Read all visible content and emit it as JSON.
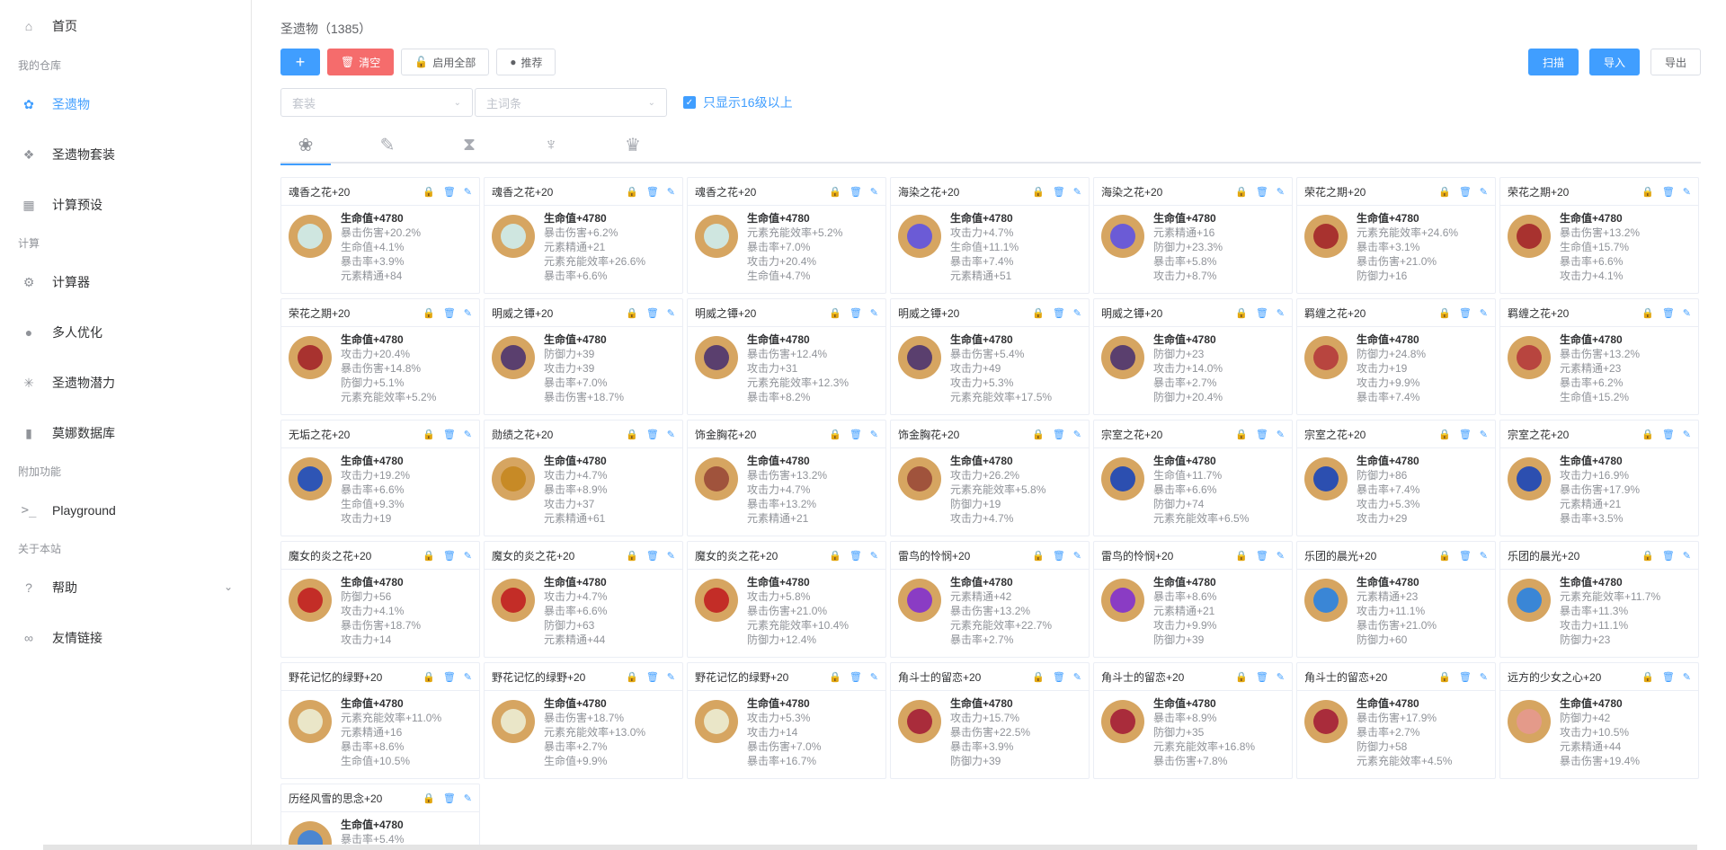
{
  "sidebar": {
    "home": "首页",
    "groups": [
      "我的仓库",
      "计算",
      "附加功能",
      "关于本站"
    ],
    "items": [
      {
        "label": "圣遗物",
        "icon": "artifact-icon"
      },
      {
        "label": "圣遗物套装",
        "icon": "set-icon"
      },
      {
        "label": "计算预设",
        "icon": "grid-icon"
      },
      {
        "label": "计算器",
        "icon": "chip-icon"
      },
      {
        "label": "多人优化",
        "icon": "bulb-icon"
      },
      {
        "label": "圣遗物潜力",
        "icon": "spark-icon"
      },
      {
        "label": "莫娜数据库",
        "icon": "bar-chart-icon"
      },
      {
        "label": "Playground",
        "icon": "terminal-icon"
      },
      {
        "label": "帮助",
        "icon": "help-icon"
      },
      {
        "label": "友情链接",
        "icon": "link-icon"
      }
    ]
  },
  "header": {
    "title": "圣遗物（1385）"
  },
  "toolbar": {
    "add": "+",
    "clear": "清空",
    "enable_all": "启用全部",
    "recommend": "推荐",
    "scan": "扫描",
    "import": "导入",
    "export": "导出"
  },
  "filters": {
    "set_placeholder": "套装",
    "main_placeholder": "主词条",
    "only_16": "只显示16级以上"
  },
  "tabs": [
    "flower-icon",
    "plume-icon",
    "sands-icon",
    "goblet-icon",
    "circlet-icon"
  ],
  "colors": {
    "primary": "#409eff",
    "danger": "#f56c6c",
    "avatar_bg": "#d6a561"
  },
  "cards": [
    {
      "name": "魂香之花+20",
      "main": "生命值+4780",
      "subs": [
        "暴击伤害+20.2%",
        "生命值+4.1%",
        "暴击率+3.9%",
        "元素精通+84"
      ],
      "gem": "#cfe6e0"
    },
    {
      "name": "魂香之花+20",
      "main": "生命值+4780",
      "subs": [
        "暴击伤害+6.2%",
        "元素精通+21",
        "元素充能效率+26.6%",
        "暴击率+6.6%"
      ],
      "gem": "#cfe6e0"
    },
    {
      "name": "魂香之花+20",
      "main": "生命值+4780",
      "subs": [
        "元素充能效率+5.2%",
        "暴击率+7.0%",
        "攻击力+20.4%",
        "生命值+4.7%"
      ],
      "gem": "#cfe6e0"
    },
    {
      "name": "海染之花+20",
      "main": "生命值+4780",
      "subs": [
        "攻击力+4.7%",
        "生命值+11.1%",
        "暴击率+7.4%",
        "元素精通+51"
      ],
      "gem": "#6b5bd6"
    },
    {
      "name": "海染之花+20",
      "main": "生命值+4780",
      "subs": [
        "元素精通+16",
        "防御力+23.3%",
        "暴击率+5.8%",
        "攻击力+8.7%"
      ],
      "gem": "#6b5bd6"
    },
    {
      "name": "荣花之期+20",
      "main": "生命值+4780",
      "subs": [
        "元素充能效率+24.6%",
        "暴击率+3.1%",
        "暴击伤害+21.0%",
        "防御力+16"
      ],
      "gem": "#a8322f"
    },
    {
      "name": "荣花之期+20",
      "main": "生命值+4780",
      "subs": [
        "暴击伤害+13.2%",
        "生命值+15.7%",
        "暴击率+6.6%",
        "攻击力+4.1%"
      ],
      "gem": "#a8322f"
    },
    {
      "name": "荣花之期+20",
      "main": "生命值+4780",
      "subs": [
        "攻击力+20.4%",
        "暴击伤害+14.8%",
        "防御力+5.1%",
        "元素充能效率+5.2%"
      ],
      "gem": "#a8322f"
    },
    {
      "name": "明威之镡+20",
      "main": "生命值+4780",
      "subs": [
        "防御力+39",
        "攻击力+39",
        "暴击率+7.0%",
        "暴击伤害+18.7%"
      ],
      "gem": "#5a3f6e"
    },
    {
      "name": "明威之镡+20",
      "main": "生命值+4780",
      "subs": [
        "暴击伤害+12.4%",
        "攻击力+31",
        "元素充能效率+12.3%",
        "暴击率+8.2%"
      ],
      "gem": "#5a3f6e"
    },
    {
      "name": "明威之镡+20",
      "main": "生命值+4780",
      "subs": [
        "暴击伤害+5.4%",
        "攻击力+49",
        "攻击力+5.3%",
        "元素充能效率+17.5%"
      ],
      "gem": "#5a3f6e"
    },
    {
      "name": "明威之镡+20",
      "main": "生命值+4780",
      "subs": [
        "防御力+23",
        "攻击力+14.0%",
        "暴击率+2.7%",
        "防御力+20.4%"
      ],
      "gem": "#5a3f6e"
    },
    {
      "name": "羁缠之花+20",
      "main": "生命值+4780",
      "subs": [
        "防御力+24.8%",
        "攻击力+19",
        "攻击力+9.9%",
        "暴击率+7.4%"
      ],
      "gem": "#b8453f"
    },
    {
      "name": "羁缠之花+20",
      "main": "生命值+4780",
      "subs": [
        "暴击伤害+13.2%",
        "元素精通+23",
        "暴击率+6.2%",
        "生命值+15.2%"
      ],
      "gem": "#b8453f"
    },
    {
      "name": "无垢之花+20",
      "main": "生命值+4780",
      "subs": [
        "攻击力+19.2%",
        "暴击率+6.6%",
        "生命值+9.3%",
        "攻击力+19"
      ],
      "gem": "#2e55b5"
    },
    {
      "name": "勋绩之花+20",
      "main": "生命值+4780",
      "subs": [
        "攻击力+4.7%",
        "暴击率+8.9%",
        "攻击力+37",
        "元素精通+61"
      ],
      "gem": "#c78a26"
    },
    {
      "name": "饰金胸花+20",
      "main": "生命值+4780",
      "subs": [
        "暴击伤害+13.2%",
        "攻击力+4.7%",
        "暴击率+13.2%",
        "元素精通+21"
      ],
      "gem": "#a0533c"
    },
    {
      "name": "饰金胸花+20",
      "main": "生命值+4780",
      "subs": [
        "攻击力+26.2%",
        "元素充能效率+5.8%",
        "防御力+19",
        "攻击力+4.7%"
      ],
      "gem": "#a0533c"
    },
    {
      "name": "宗室之花+20",
      "main": "生命值+4780",
      "subs": [
        "生命值+11.7%",
        "暴击率+6.6%",
        "防御力+74",
        "元素充能效率+6.5%"
      ],
      "gem": "#2c4fb0"
    },
    {
      "name": "宗室之花+20",
      "main": "生命值+4780",
      "subs": [
        "防御力+86",
        "暴击率+7.4%",
        "攻击力+5.3%",
        "攻击力+29"
      ],
      "gem": "#2c4fb0"
    },
    {
      "name": "宗室之花+20",
      "main": "生命值+4780",
      "subs": [
        "攻击力+16.9%",
        "暴击伤害+17.9%",
        "元素精通+21",
        "暴击率+3.5%"
      ],
      "gem": "#2c4fb0"
    },
    {
      "name": "魔女的炎之花+20",
      "main": "生命值+4780",
      "subs": [
        "防御力+56",
        "攻击力+4.1%",
        "暴击伤害+18.7%",
        "攻击力+14"
      ],
      "gem": "#c32d27"
    },
    {
      "name": "魔女的炎之花+20",
      "main": "生命值+4780",
      "subs": [
        "攻击力+4.7%",
        "暴击率+6.6%",
        "防御力+63",
        "元素精通+44"
      ],
      "gem": "#c32d27"
    },
    {
      "name": "魔女的炎之花+20",
      "main": "生命值+4780",
      "subs": [
        "攻击力+5.8%",
        "暴击伤害+21.0%",
        "元素充能效率+10.4%",
        "防御力+12.4%"
      ],
      "gem": "#c32d27"
    },
    {
      "name": "雷鸟的怜悯+20",
      "main": "生命值+4780",
      "subs": [
        "元素精通+42",
        "暴击伤害+13.2%",
        "元素充能效率+22.7%",
        "暴击率+2.7%"
      ],
      "gem": "#8a3cc4"
    },
    {
      "name": "雷鸟的怜悯+20",
      "main": "生命值+4780",
      "subs": [
        "暴击率+8.6%",
        "元素精通+21",
        "攻击力+9.9%",
        "防御力+39"
      ],
      "gem": "#8a3cc4"
    },
    {
      "name": "乐团的晨光+20",
      "main": "生命值+4780",
      "subs": [
        "元素精通+23",
        "攻击力+11.1%",
        "暴击伤害+21.0%",
        "防御力+60"
      ],
      "gem": "#3a86d6"
    },
    {
      "name": "乐团的晨光+20",
      "main": "生命值+4780",
      "subs": [
        "元素充能效率+11.7%",
        "暴击率+11.3%",
        "攻击力+11.1%",
        "防御力+23"
      ],
      "gem": "#3a86d6"
    },
    {
      "name": "野花记忆的绿野+20",
      "main": "生命值+4780",
      "subs": [
        "元素充能效率+11.0%",
        "元素精通+16",
        "暴击率+8.6%",
        "生命值+10.5%"
      ],
      "gem": "#eae6c8"
    },
    {
      "name": "野花记忆的绿野+20",
      "main": "生命值+4780",
      "subs": [
        "暴击伤害+18.7%",
        "元素充能效率+13.0%",
        "暴击率+2.7%",
        "生命值+9.9%"
      ],
      "gem": "#eae6c8"
    },
    {
      "name": "野花记忆的绿野+20",
      "main": "生命值+4780",
      "subs": [
        "攻击力+5.3%",
        "攻击力+14",
        "暴击伤害+7.0%",
        "暴击率+16.7%"
      ],
      "gem": "#eae6c8"
    },
    {
      "name": "角斗士的留恋+20",
      "main": "生命值+4780",
      "subs": [
        "攻击力+15.7%",
        "暴击伤害+22.5%",
        "暴击率+3.9%",
        "防御力+39"
      ],
      "gem": "#a92c3b"
    },
    {
      "name": "角斗士的留恋+20",
      "main": "生命值+4780",
      "subs": [
        "暴击率+8.9%",
        "防御力+35",
        "元素充能效率+16.8%",
        "暴击伤害+7.8%"
      ],
      "gem": "#a92c3b"
    },
    {
      "name": "角斗士的留恋+20",
      "main": "生命值+4780",
      "subs": [
        "暴击伤害+17.9%",
        "暴击率+2.7%",
        "防御力+58",
        "元素充能效率+4.5%"
      ],
      "gem": "#a92c3b"
    },
    {
      "name": "远方的少女之心+20",
      "main": "生命值+4780",
      "subs": [
        "防御力+42",
        "攻击力+10.5%",
        "元素精通+44",
        "暴击伤害+19.4%"
      ],
      "gem": "#e49a8a"
    },
    {
      "name": "历经风雪的思念+20",
      "main": "生命值+4780",
      "subs": [
        "暴击率+5.4%"
      ],
      "gem": "#4b86d0"
    }
  ]
}
